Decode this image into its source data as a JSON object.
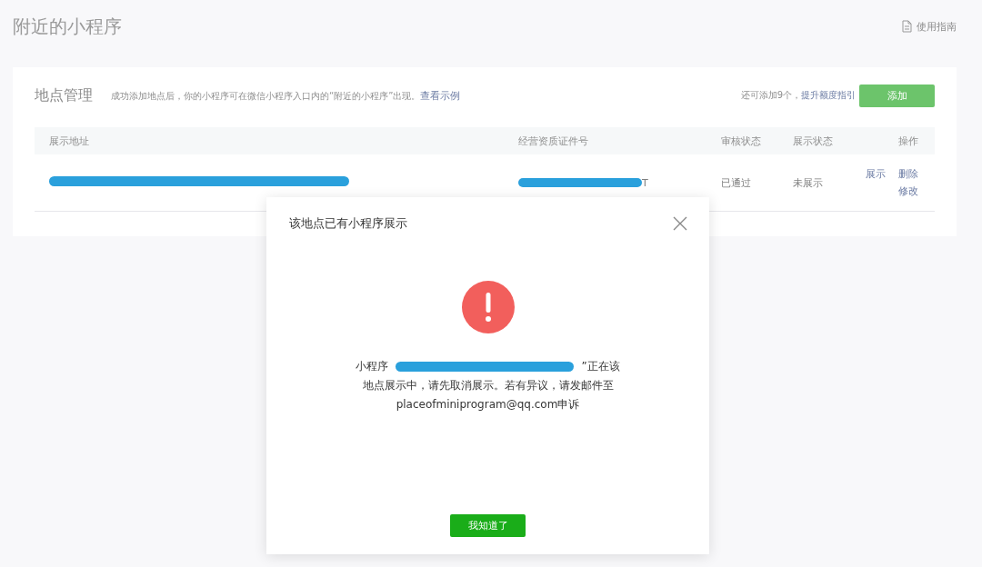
{
  "page": {
    "title": "附近的小程序",
    "guide_link": "使用指南"
  },
  "location_card": {
    "title": "地点管理",
    "description": "成功添加地点后，你的小程序可在微信小程序入口内的“附近的小程序”出现。",
    "example_link": "查看示例",
    "quota_text": "还可添加9个，",
    "quota_link": "提升额度指引",
    "add_button": "添加"
  },
  "table": {
    "columns": [
      "展示地址",
      "经营资质证件号",
      "审核状态",
      "展示状态",
      "操作"
    ],
    "rows": [
      {
        "license_suffix": "T",
        "review_status": "已通过",
        "display_status": "未展示",
        "actions": [
          "展示",
          "删除",
          "修改"
        ]
      }
    ]
  },
  "dialog": {
    "title": "该地点已有小程序展示",
    "message_prefix": "小程序",
    "message_suffix": "”正在该",
    "message_rest": "地点展示中，请先取消展示。若有异议，请发邮件至placeofminiprogram@qq.com申诉",
    "confirm_button": "我知道了"
  }
}
